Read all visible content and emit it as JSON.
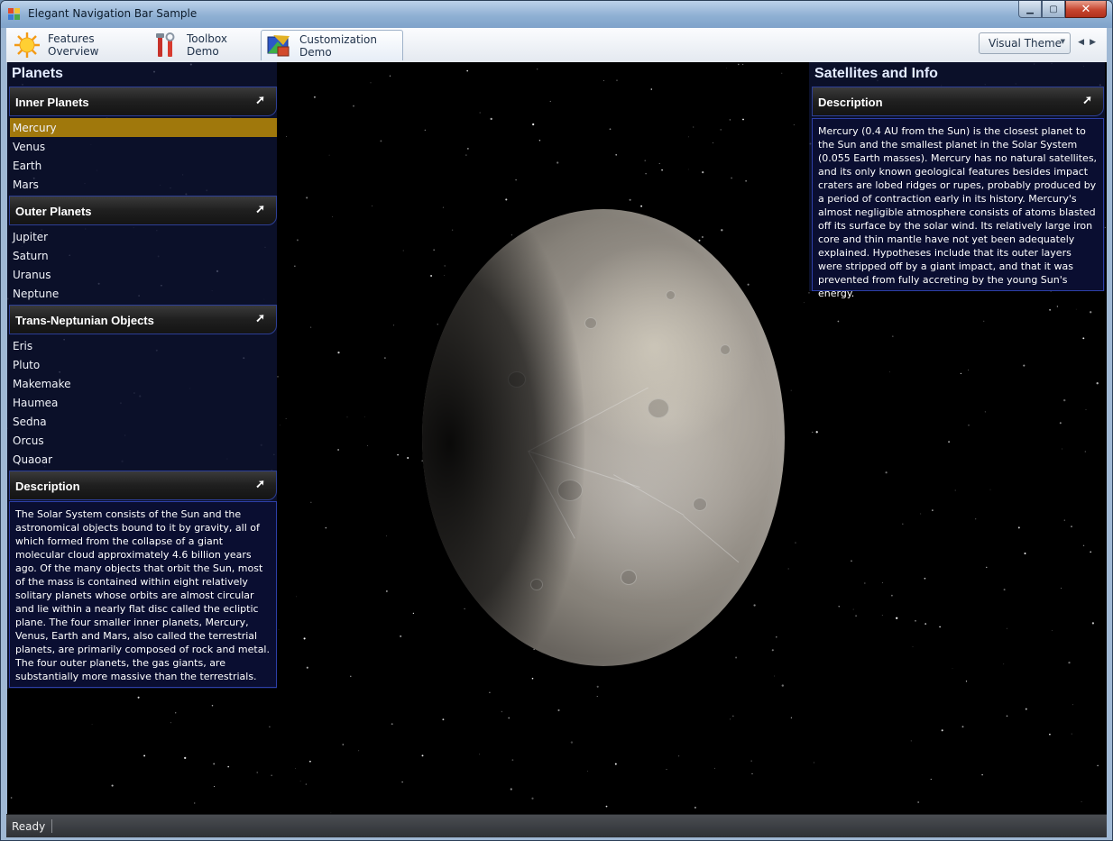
{
  "window": {
    "title": "Elegant Navigation Bar Sample",
    "icon": "app-window-icon",
    "controls": {
      "minimize": "▁",
      "maximize": "▢",
      "close": "✕"
    }
  },
  "tabs": [
    {
      "label": "Features Overview",
      "icon": "sun-icon",
      "active": false
    },
    {
      "label": "Toolbox Demo",
      "icon": "toolbox-icon",
      "active": false
    },
    {
      "label": "Customization Demo",
      "icon": "customization-icon",
      "active": true
    }
  ],
  "toolbar": {
    "theme_label": "Visual Theme",
    "scroll_left": "◀",
    "scroll_right": "▶"
  },
  "left_panel": {
    "title": "Planets",
    "groups": [
      {
        "header": "Inner Planets",
        "items": [
          "Mercury",
          "Venus",
          "Earth",
          "Mars"
        ]
      },
      {
        "header": "Outer Planets",
        "items": [
          "Jupiter",
          "Saturn",
          "Uranus",
          "Neptune"
        ]
      },
      {
        "header": "Trans-Neptunian Objects",
        "items": [
          "Eris",
          "Pluto",
          "Makemake",
          "Haumea",
          "Sedna",
          "Orcus",
          "Quaoar"
        ]
      }
    ],
    "selected_item": "Mercury",
    "description": {
      "header": "Description",
      "text": "The Solar System consists of the Sun and the astronomical objects bound to it by gravity, all of which formed from the collapse of a giant molecular cloud approximately 4.6 billion years ago. Of the many objects that orbit the Sun, most of the mass is contained within eight relatively solitary planets whose orbits are almost circular and lie within a nearly flat disc called the ecliptic plane. The four smaller inner planets, Mercury, Venus, Earth and Mars, also called the terrestrial planets, are primarily composed of rock and metal. The four outer planets, the gas giants, are substantially more massive than the terrestrials."
    }
  },
  "right_panel": {
    "title": "Satellites and Info",
    "description": {
      "header": "Description",
      "text": "Mercury (0.4 AU from the Sun) is the closest planet to the Sun and the smallest planet in the Solar System (0.055 Earth masses). Mercury has no natural satellites, and its only known geological features besides impact craters are lobed ridges or rupes, probably produced by a period of contraction early in its history. Mercury's almost negligible atmosphere consists of atoms blasted off its surface by the solar wind. Its relatively large iron core and thin mantle have not yet been adequately explained. Hypotheses include that its outer layers were stripped off by a giant impact, and that it was prevented from fully accreting by the young Sun's energy."
    }
  },
  "expand_glyph": "➚",
  "status": {
    "text": "Ready"
  },
  "colors": {
    "selected_item": "#a0780c",
    "header_border": "#2d3f96",
    "panel_bg": "#0e1434",
    "title_text": "#e4ecff"
  }
}
